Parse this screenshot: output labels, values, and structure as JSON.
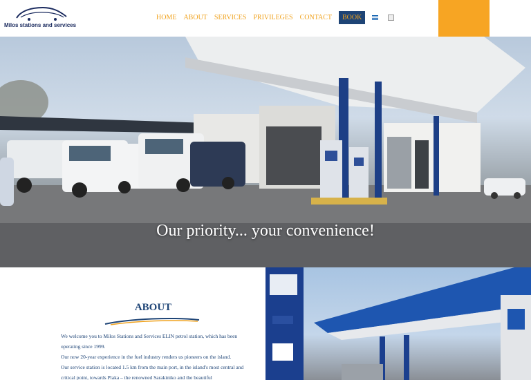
{
  "brand": {
    "name": "Milos stations and services"
  },
  "nav": {
    "items": [
      {
        "label": "HOME"
      },
      {
        "label": "ABOUT"
      },
      {
        "label": "SERVICES"
      },
      {
        "label": "PRIVILEGES"
      },
      {
        "label": "CONTACT"
      }
    ],
    "book_label": "BOOK",
    "language_flag": "greek-flag-icon"
  },
  "hero": {
    "caption": "Our priority... your convenience!"
  },
  "about": {
    "title": "ABOUT",
    "paragraphs": [
      "We welcome you to Milos Stations and Services ELIN petrol station, which has been operating since 1999.",
      "Our now 20-year experience in the fuel industry renders us pioneers on the island.",
      "Our service station is located 1.5 km from the main port, in the island's most central and critical point, towards Plaka – the renowned Sarakiniko and the beautiful"
    ]
  },
  "colors": {
    "accent": "#f0a21d",
    "brand_navy": "#1e4476",
    "orange_block": "#f7a523"
  }
}
